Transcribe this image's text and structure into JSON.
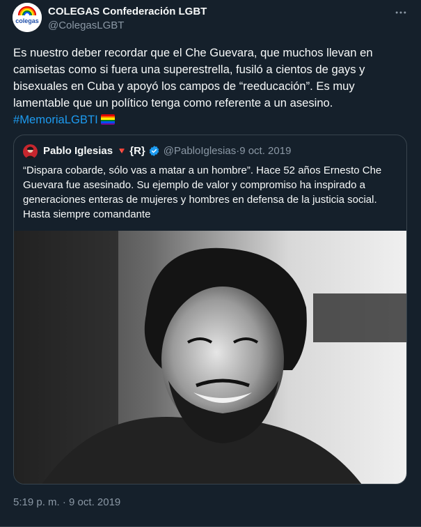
{
  "author": {
    "name": "COLEGAS Confederación LGBT",
    "handle": "@ColegasLGBT",
    "avatar_logo_text": "colegas",
    "avatar_icon": "colegas-logo-icon"
  },
  "more_icon": "more-horizontal-icon",
  "tweet": {
    "text": "Es nuestro deber recordar que el Che Guevara, que muchos llevan en camisetas como si fuera una superestrella, fusiló a cientos de gays y bisexuales en Cuba y apoyó los campos de “reeducación”. Es muy lamentable que un político tenga como referente a un asesino. ",
    "hashtag": "#MemoriaLGBTI",
    "emoji_icon": "rainbow-flag-icon",
    "flag_colors": [
      "#e40303",
      "#ff8c00",
      "#ffed00",
      "#008026",
      "#004dff",
      "#750787"
    ]
  },
  "quoted": {
    "name": "Pablo Iglesias",
    "triangle": "🔻",
    "tag": "{R}",
    "verified_icon": "verified-badge-icon",
    "handle": "@PabloIglesias",
    "separator": " · ",
    "date": "9 oct. 2019",
    "text": "“Dispara cobarde, sólo vas a matar a un hombre”. Hace 52 años Ernesto Che Guevara fue asesinado. Su ejemplo de valor y compromiso ha inspirado a generaciones enteras de mujeres y hombres en defensa de la justicia social. Hasta siempre comandante",
    "photo_icon": "che-guevara-photo"
  },
  "timestamp": {
    "time": "5:19 p. m.",
    "separator": " · ",
    "date": "9 oct. 2019"
  },
  "colors": {
    "background": "#15202b",
    "text": "#f7f9f9",
    "secondary": "#8b98a5",
    "accent": "#1d9bf0",
    "border": "#38444d",
    "verified": "#1d9bf0"
  }
}
